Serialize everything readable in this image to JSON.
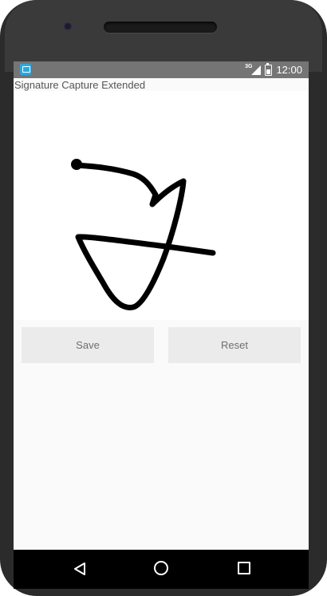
{
  "status_bar": {
    "network_label": "3G",
    "time": "12:00",
    "app_icon": "app-notification-icon",
    "signal_icon": "signal-icon",
    "battery_icon": "battery-icon"
  },
  "app": {
    "title": "Signature Capture Extended"
  },
  "buttons": {
    "save_label": "Save",
    "reset_label": "Reset"
  },
  "navigation": {
    "back_icon": "back-icon",
    "home_icon": "home-icon",
    "recents_icon": "recents-icon"
  },
  "colors": {
    "status_bar": "#757575",
    "button_bg": "#ebebeb",
    "stroke": "#000000",
    "nav_bar": "#000000"
  }
}
